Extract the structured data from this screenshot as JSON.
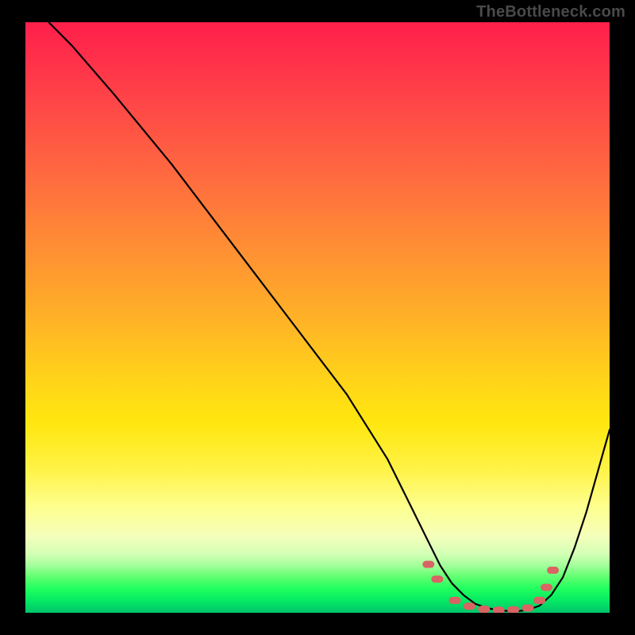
{
  "watermark": "TheBottleneck.com",
  "colors": {
    "curve": "#000000",
    "marker": "#da6363",
    "frame": "#000000"
  },
  "chart_data": {
    "type": "line",
    "title": "",
    "xlabel": "",
    "ylabel": "",
    "xlim": [
      0,
      100
    ],
    "ylim": [
      0,
      100
    ],
    "series": [
      {
        "name": "bottleneck-curve",
        "x": [
          4,
          8,
          15,
          25,
          35,
          45,
          55,
          62,
          66,
          69,
          71,
          73,
          75,
          77,
          79,
          81,
          83,
          84.5,
          86,
          88,
          90,
          92,
          94,
          96,
          98,
          100
        ],
        "y": [
          100,
          96,
          88,
          76,
          63,
          50,
          37,
          26,
          18,
          12,
          8,
          5,
          3,
          1.5,
          0.8,
          0.4,
          0.3,
          0.3,
          0.5,
          1.2,
          3,
          6,
          11,
          17,
          24,
          31
        ]
      }
    ],
    "markers": {
      "name": "optimal-range",
      "shape": "rounded-bar",
      "points": [
        {
          "x": 69,
          "y": 8.2
        },
        {
          "x": 70.5,
          "y": 5.7
        },
        {
          "x": 73.5,
          "y": 2.1
        },
        {
          "x": 76,
          "y": 1.1
        },
        {
          "x": 78.5,
          "y": 0.6
        },
        {
          "x": 81,
          "y": 0.45
        },
        {
          "x": 83.5,
          "y": 0.5
        },
        {
          "x": 86,
          "y": 0.8
        },
        {
          "x": 88,
          "y": 2.1
        },
        {
          "x": 89.2,
          "y": 4.3
        },
        {
          "x": 90.3,
          "y": 7.2
        }
      ]
    },
    "background_gradient": {
      "orientation": "vertical",
      "stops": [
        {
          "pos": 0.0,
          "color": "#ff1f4b"
        },
        {
          "pos": 0.26,
          "color": "#ff6a3f"
        },
        {
          "pos": 0.5,
          "color": "#ffb127"
        },
        {
          "pos": 0.76,
          "color": "#fff34a"
        },
        {
          "pos": 0.9,
          "color": "#d4ffb6"
        },
        {
          "pos": 1.0,
          "color": "#00c46b"
        }
      ]
    }
  }
}
